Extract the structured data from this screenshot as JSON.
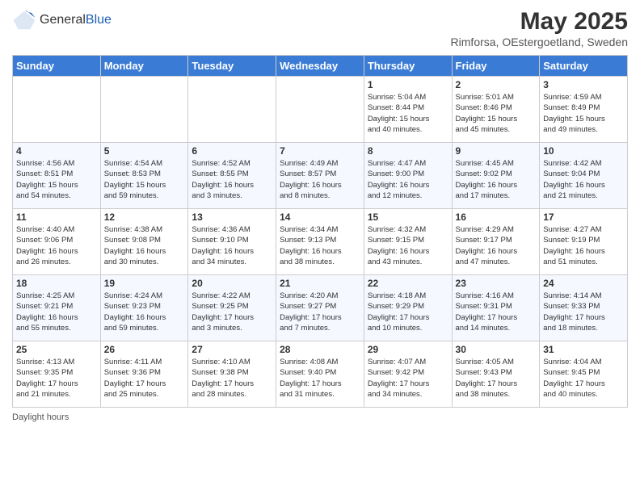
{
  "header": {
    "logo_general": "General",
    "logo_blue": "Blue",
    "main_title": "May 2025",
    "subtitle": "Rimforsa, OEstergoetland, Sweden"
  },
  "calendar": {
    "days_of_week": [
      "Sunday",
      "Monday",
      "Tuesday",
      "Wednesday",
      "Thursday",
      "Friday",
      "Saturday"
    ],
    "weeks": [
      [
        {
          "day": "",
          "info": ""
        },
        {
          "day": "",
          "info": ""
        },
        {
          "day": "",
          "info": ""
        },
        {
          "day": "",
          "info": ""
        },
        {
          "day": "1",
          "info": "Sunrise: 5:04 AM\nSunset: 8:44 PM\nDaylight: 15 hours\nand 40 minutes."
        },
        {
          "day": "2",
          "info": "Sunrise: 5:01 AM\nSunset: 8:46 PM\nDaylight: 15 hours\nand 45 minutes."
        },
        {
          "day": "3",
          "info": "Sunrise: 4:59 AM\nSunset: 8:49 PM\nDaylight: 15 hours\nand 49 minutes."
        }
      ],
      [
        {
          "day": "4",
          "info": "Sunrise: 4:56 AM\nSunset: 8:51 PM\nDaylight: 15 hours\nand 54 minutes."
        },
        {
          "day": "5",
          "info": "Sunrise: 4:54 AM\nSunset: 8:53 PM\nDaylight: 15 hours\nand 59 minutes."
        },
        {
          "day": "6",
          "info": "Sunrise: 4:52 AM\nSunset: 8:55 PM\nDaylight: 16 hours\nand 3 minutes."
        },
        {
          "day": "7",
          "info": "Sunrise: 4:49 AM\nSunset: 8:57 PM\nDaylight: 16 hours\nand 8 minutes."
        },
        {
          "day": "8",
          "info": "Sunrise: 4:47 AM\nSunset: 9:00 PM\nDaylight: 16 hours\nand 12 minutes."
        },
        {
          "day": "9",
          "info": "Sunrise: 4:45 AM\nSunset: 9:02 PM\nDaylight: 16 hours\nand 17 minutes."
        },
        {
          "day": "10",
          "info": "Sunrise: 4:42 AM\nSunset: 9:04 PM\nDaylight: 16 hours\nand 21 minutes."
        }
      ],
      [
        {
          "day": "11",
          "info": "Sunrise: 4:40 AM\nSunset: 9:06 PM\nDaylight: 16 hours\nand 26 minutes."
        },
        {
          "day": "12",
          "info": "Sunrise: 4:38 AM\nSunset: 9:08 PM\nDaylight: 16 hours\nand 30 minutes."
        },
        {
          "day": "13",
          "info": "Sunrise: 4:36 AM\nSunset: 9:10 PM\nDaylight: 16 hours\nand 34 minutes."
        },
        {
          "day": "14",
          "info": "Sunrise: 4:34 AM\nSunset: 9:13 PM\nDaylight: 16 hours\nand 38 minutes."
        },
        {
          "day": "15",
          "info": "Sunrise: 4:32 AM\nSunset: 9:15 PM\nDaylight: 16 hours\nand 43 minutes."
        },
        {
          "day": "16",
          "info": "Sunrise: 4:29 AM\nSunset: 9:17 PM\nDaylight: 16 hours\nand 47 minutes."
        },
        {
          "day": "17",
          "info": "Sunrise: 4:27 AM\nSunset: 9:19 PM\nDaylight: 16 hours\nand 51 minutes."
        }
      ],
      [
        {
          "day": "18",
          "info": "Sunrise: 4:25 AM\nSunset: 9:21 PM\nDaylight: 16 hours\nand 55 minutes."
        },
        {
          "day": "19",
          "info": "Sunrise: 4:24 AM\nSunset: 9:23 PM\nDaylight: 16 hours\nand 59 minutes."
        },
        {
          "day": "20",
          "info": "Sunrise: 4:22 AM\nSunset: 9:25 PM\nDaylight: 17 hours\nand 3 minutes."
        },
        {
          "day": "21",
          "info": "Sunrise: 4:20 AM\nSunset: 9:27 PM\nDaylight: 17 hours\nand 7 minutes."
        },
        {
          "day": "22",
          "info": "Sunrise: 4:18 AM\nSunset: 9:29 PM\nDaylight: 17 hours\nand 10 minutes."
        },
        {
          "day": "23",
          "info": "Sunrise: 4:16 AM\nSunset: 9:31 PM\nDaylight: 17 hours\nand 14 minutes."
        },
        {
          "day": "24",
          "info": "Sunrise: 4:14 AM\nSunset: 9:33 PM\nDaylight: 17 hours\nand 18 minutes."
        }
      ],
      [
        {
          "day": "25",
          "info": "Sunrise: 4:13 AM\nSunset: 9:35 PM\nDaylight: 17 hours\nand 21 minutes."
        },
        {
          "day": "26",
          "info": "Sunrise: 4:11 AM\nSunset: 9:36 PM\nDaylight: 17 hours\nand 25 minutes."
        },
        {
          "day": "27",
          "info": "Sunrise: 4:10 AM\nSunset: 9:38 PM\nDaylight: 17 hours\nand 28 minutes."
        },
        {
          "day": "28",
          "info": "Sunrise: 4:08 AM\nSunset: 9:40 PM\nDaylight: 17 hours\nand 31 minutes."
        },
        {
          "day": "29",
          "info": "Sunrise: 4:07 AM\nSunset: 9:42 PM\nDaylight: 17 hours\nand 34 minutes."
        },
        {
          "day": "30",
          "info": "Sunrise: 4:05 AM\nSunset: 9:43 PM\nDaylight: 17 hours\nand 38 minutes."
        },
        {
          "day": "31",
          "info": "Sunrise: 4:04 AM\nSunset: 9:45 PM\nDaylight: 17 hours\nand 40 minutes."
        }
      ]
    ]
  },
  "footer": {
    "daylight_label": "Daylight hours"
  }
}
